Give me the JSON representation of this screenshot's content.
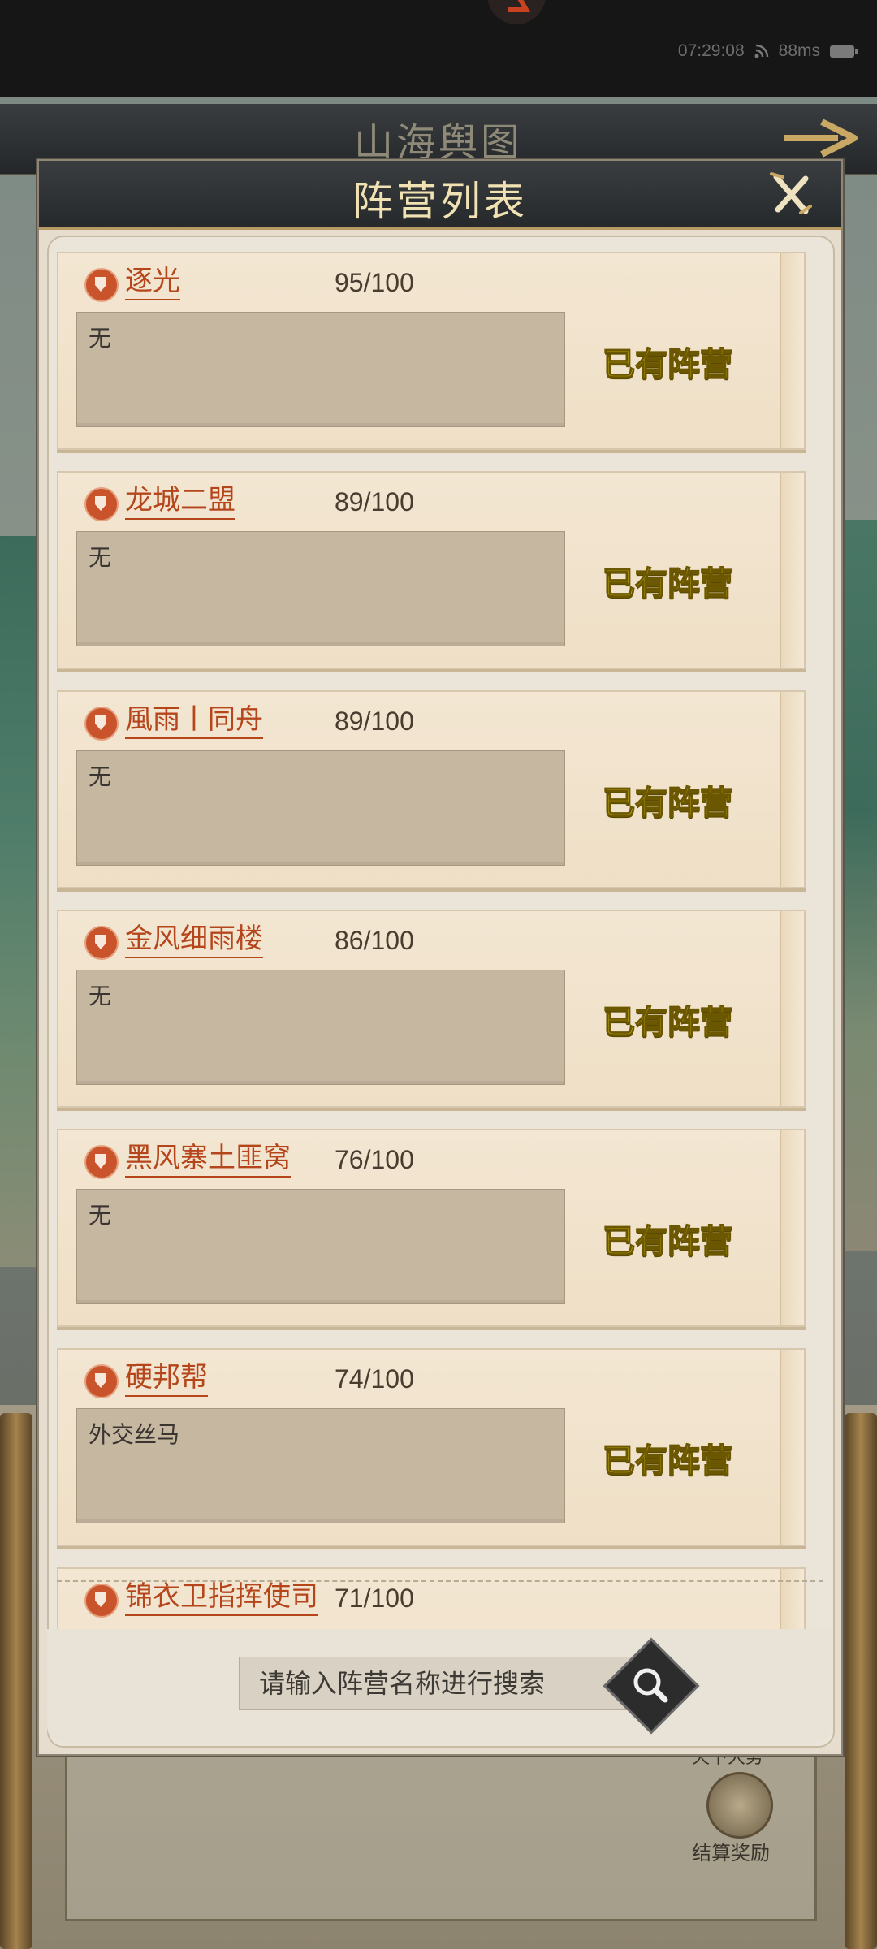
{
  "status_bar": {
    "time": "07:29:08",
    "ping": "88ms"
  },
  "background": {
    "screen_title": "山海舆图",
    "partial_label": "天下大势",
    "reward_label": "结算奖励"
  },
  "dialog": {
    "title": "阵营列表",
    "camps": [
      {
        "name": "逐光",
        "count": "95/100",
        "desc": "无",
        "status": "已有阵营"
      },
      {
        "name": "龙城二盟",
        "count": "89/100",
        "desc": "无",
        "status": "已有阵营"
      },
      {
        "name": "風雨丨同舟",
        "count": "89/100",
        "desc": "无",
        "status": "已有阵营"
      },
      {
        "name": "金风细雨楼",
        "count": "86/100",
        "desc": "无",
        "status": "已有阵营"
      },
      {
        "name": "黑风寨土匪窝",
        "count": "76/100",
        "desc": "无",
        "status": "已有阵营"
      },
      {
        "name": "硬邦帮",
        "count": "74/100",
        "desc": "外交丝马",
        "status": "已有阵营"
      },
      {
        "name": "锦衣卫指挥使司",
        "count": "71/100",
        "desc": "",
        "status": ""
      }
    ],
    "search": {
      "placeholder": "请输入阵营名称进行搜索"
    }
  }
}
